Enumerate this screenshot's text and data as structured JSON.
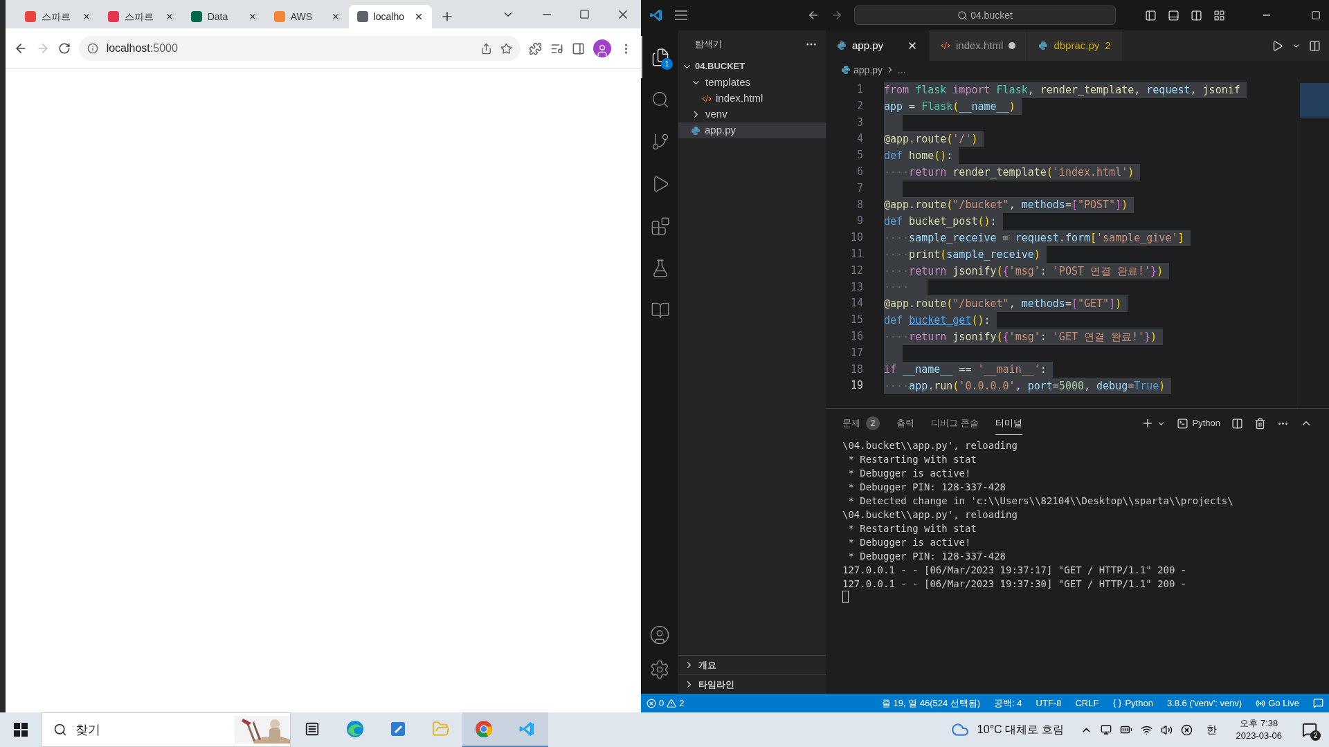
{
  "browser": {
    "tabs": [
      {
        "title": "스파르",
        "selected": false,
        "color": "#e8453c"
      },
      {
        "title": "스파르",
        "selected": false,
        "color": "#e8344e"
      },
      {
        "title": "Data",
        "selected": false,
        "color": "#00684a"
      },
      {
        "title": "AWS",
        "selected": false,
        "color": "#f58536"
      },
      {
        "title": "localho",
        "selected": true,
        "color": "#5f6368"
      }
    ],
    "address": {
      "host": "localhost",
      "port": ":5000"
    }
  },
  "vscode": {
    "title_search": "04.bucket",
    "activity": [
      {
        "kind": "files",
        "selected": true,
        "badge": "1"
      },
      {
        "kind": "search",
        "selected": false
      },
      {
        "kind": "git",
        "selected": false
      },
      {
        "kind": "debug",
        "selected": false
      },
      {
        "kind": "extensions",
        "selected": false
      },
      {
        "kind": "testing",
        "selected": false
      },
      {
        "kind": "notebook",
        "selected": false
      }
    ],
    "sidebar": {
      "title": "탐색기",
      "root": "04.BUCKET",
      "items": [
        {
          "name": "templates",
          "kind": "folder",
          "expanded": true,
          "selected": false,
          "children": [
            {
              "name": "index.html",
              "kind": "html",
              "selected": false
            }
          ]
        },
        {
          "name": "venv",
          "kind": "folder",
          "expanded": false,
          "selected": false
        },
        {
          "name": "app.py",
          "kind": "python",
          "selected": true
        }
      ],
      "sections": [
        {
          "title": "개요",
          "expanded": false
        },
        {
          "title": "타임라인",
          "expanded": false
        }
      ]
    },
    "editor_tabs": [
      {
        "name": "app.py",
        "kind": "python",
        "selected": true,
        "modified": false
      },
      {
        "name": "index.html",
        "kind": "html",
        "selected": false,
        "modified": true
      },
      {
        "name": "dbprac.py",
        "kind": "python",
        "selected": false,
        "modified": false,
        "problems": "2"
      }
    ],
    "breadcrumb": [
      "app.py",
      "..."
    ],
    "code": {
      "selected": true,
      "lines": [
        {
          "n": "1",
          "current": false,
          "indent": false,
          "tokens": [
            {
              "text": "from",
              "kind": "kw"
            },
            {
              "text": " flask",
              "kind": "cls"
            },
            {
              "text": " import",
              "kind": "kw"
            },
            {
              "text": " Flask",
              "kind": "cls"
            },
            {
              "text": ", ",
              "kind": "p"
            },
            {
              "text": "render_template",
              "kind": "fn"
            },
            {
              "text": ", ",
              "kind": "p"
            },
            {
              "text": "request",
              "kind": "var"
            },
            {
              "text": ", ",
              "kind": "p"
            },
            {
              "text": "jsonif",
              "kind": "fn"
            }
          ]
        },
        {
          "n": "2",
          "current": false,
          "indent": false,
          "tokens": [
            {
              "text": "app",
              "kind": "var"
            },
            {
              "text": " = ",
              "kind": "p"
            },
            {
              "text": "Flask",
              "kind": "cls"
            },
            {
              "text": "(",
              "kind": "b1"
            },
            {
              "text": "__name__",
              "kind": "var"
            },
            {
              "text": ")",
              "kind": "b1"
            }
          ]
        },
        {
          "n": "3",
          "current": false,
          "indent": false
        },
        {
          "n": "4",
          "current": false,
          "indent": false,
          "tokens": [
            {
              "text": "@app.route",
              "kind": "fn"
            },
            {
              "text": "(",
              "kind": "b1"
            },
            {
              "text": "'/'",
              "kind": "str"
            },
            {
              "text": ")",
              "kind": "b1"
            }
          ]
        },
        {
          "n": "5",
          "current": false,
          "indent": false,
          "tokens": [
            {
              "text": "def",
              "kind": "st"
            },
            {
              "text": " home",
              "kind": "fn"
            },
            {
              "text": "()",
              "kind": "b1"
            },
            {
              "text": ":",
              "kind": "p"
            }
          ]
        },
        {
          "n": "6",
          "current": false,
          "indent": true,
          "tokens": [
            {
              "text": "return",
              "kind": "kw"
            },
            {
              "text": " render_template",
              "kind": "fn"
            },
            {
              "text": "(",
              "kind": "b1"
            },
            {
              "text": "'index.html'",
              "kind": "str"
            },
            {
              "text": ")",
              "kind": "b1"
            }
          ]
        },
        {
          "n": "7",
          "current": false,
          "indent": false
        },
        {
          "n": "8",
          "current": false,
          "indent": false,
          "tokens": [
            {
              "text": "@app.route",
              "kind": "fn"
            },
            {
              "text": "(",
              "kind": "b1"
            },
            {
              "text": "\"/bucket\"",
              "kind": "str"
            },
            {
              "text": ", ",
              "kind": "p"
            },
            {
              "text": "methods",
              "kind": "var"
            },
            {
              "text": "=",
              "kind": "p"
            },
            {
              "text": "[",
              "kind": "b2"
            },
            {
              "text": "\"POST\"",
              "kind": "str"
            },
            {
              "text": "]",
              "kind": "b2"
            },
            {
              "text": ")",
              "kind": "b1"
            }
          ]
        },
        {
          "n": "9",
          "current": false,
          "indent": false,
          "tokens": [
            {
              "text": "def",
              "kind": "st"
            },
            {
              "text": " bucket_post",
              "kind": "fn"
            },
            {
              "text": "()",
              "kind": "b1"
            },
            {
              "text": ":",
              "kind": "p"
            }
          ]
        },
        {
          "n": "10",
          "current": false,
          "indent": true,
          "tokens": [
            {
              "text": "sample_receive",
              "kind": "var"
            },
            {
              "text": " = ",
              "kind": "p"
            },
            {
              "text": "request",
              "kind": "var"
            },
            {
              "text": ".",
              "kind": "p"
            },
            {
              "text": "form",
              "kind": "var"
            },
            {
              "text": "[",
              "kind": "b1"
            },
            {
              "text": "'sample_give'",
              "kind": "str"
            },
            {
              "text": "]",
              "kind": "b1"
            }
          ]
        },
        {
          "n": "11",
          "current": false,
          "indent": true,
          "tokens": [
            {
              "text": "print",
              "kind": "fn"
            },
            {
              "text": "(",
              "kind": "b1"
            },
            {
              "text": "sample_receive",
              "kind": "var"
            },
            {
              "text": ")",
              "kind": "b1"
            }
          ]
        },
        {
          "n": "12",
          "current": false,
          "indent": true,
          "tokens": [
            {
              "text": "return",
              "kind": "kw"
            },
            {
              "text": " jsonify",
              "kind": "fn"
            },
            {
              "text": "(",
              "kind": "b1"
            },
            {
              "text": "{",
              "kind": "b2"
            },
            {
              "text": "'msg'",
              "kind": "str"
            },
            {
              "text": ": ",
              "kind": "p"
            },
            {
              "text": "'POST 연결 완료!'",
              "kind": "str"
            },
            {
              "text": "}",
              "kind": "b2"
            },
            {
              "text": ")",
              "kind": "b1"
            }
          ]
        },
        {
          "n": "13",
          "current": false,
          "indent": true
        },
        {
          "n": "14",
          "current": false,
          "indent": false,
          "tokens": [
            {
              "text": "@app.route",
              "kind": "fn"
            },
            {
              "text": "(",
              "kind": "b1"
            },
            {
              "text": "\"/bucket\"",
              "kind": "str"
            },
            {
              "text": ", ",
              "kind": "p"
            },
            {
              "text": "methods",
              "kind": "var"
            },
            {
              "text": "=",
              "kind": "p"
            },
            {
              "text": "[",
              "kind": "b2"
            },
            {
              "text": "\"GET\"",
              "kind": "str"
            },
            {
              "text": "]",
              "kind": "b2"
            },
            {
              "text": ")",
              "kind": "b1"
            }
          ]
        },
        {
          "n": "15",
          "current": false,
          "indent": false,
          "tokens": [
            {
              "text": "def ",
              "kind": "st"
            },
            {
              "text": "bucket_get",
              "kind": "link"
            },
            {
              "text": "()",
              "kind": "b1"
            },
            {
              "text": ":",
              "kind": "p"
            }
          ]
        },
        {
          "n": "16",
          "current": false,
          "indent": true,
          "tokens": [
            {
              "text": "return",
              "kind": "kw"
            },
            {
              "text": " jsonify",
              "kind": "fn"
            },
            {
              "text": "(",
              "kind": "b1"
            },
            {
              "text": "{",
              "kind": "b2"
            },
            {
              "text": "'msg'",
              "kind": "str"
            },
            {
              "text": ": ",
              "kind": "p"
            },
            {
              "text": "'GET 연결 완료!'",
              "kind": "str"
            },
            {
              "text": "}",
              "kind": "b2"
            },
            {
              "text": ")",
              "kind": "b1"
            }
          ]
        },
        {
          "n": "17",
          "current": false,
          "indent": false
        },
        {
          "n": "18",
          "current": false,
          "indent": false,
          "tokens": [
            {
              "text": "if",
              "kind": "kw"
            },
            {
              "text": " __name__",
              "kind": "var"
            },
            {
              "text": " == ",
              "kind": "p"
            },
            {
              "text": "'__main__'",
              "kind": "str"
            },
            {
              "text": ":",
              "kind": "p"
            }
          ]
        },
        {
          "n": "19",
          "current": true,
          "indent": true,
          "tokens": [
            {
              "text": "app",
              "kind": "var"
            },
            {
              "text": ".",
              "kind": "p"
            },
            {
              "text": "run",
              "kind": "fn"
            },
            {
              "text": "(",
              "kind": "b1"
            },
            {
              "text": "'0.0.0.0'",
              "kind": "str"
            },
            {
              "text": ", ",
              "kind": "p"
            },
            {
              "text": "port",
              "kind": "var"
            },
            {
              "text": "=",
              "kind": "p"
            },
            {
              "text": "5000",
              "kind": "num"
            },
            {
              "text": ", ",
              "kind": "p"
            },
            {
              "text": "debug",
              "kind": "var"
            },
            {
              "text": "=",
              "kind": "p"
            },
            {
              "text": "True",
              "kind": "st"
            },
            {
              "text": ")",
              "kind": "b1"
            }
          ]
        }
      ]
    },
    "panel": {
      "tabs": [
        {
          "label": "문제",
          "selected": false,
          "badge": "2"
        },
        {
          "label": "출력",
          "selected": false
        },
        {
          "label": "디버그 콘솔",
          "selected": false
        },
        {
          "label": "터미널",
          "selected": true
        }
      ],
      "terminal_name": "Python",
      "lines": [
        "\\04.bucket\\\\app.py', reloading",
        " * Restarting with stat",
        " * Debugger is active!",
        " * Debugger PIN: 128-337-428",
        " * Detected change in 'c:\\\\Users\\\\82104\\\\Desktop\\\\sparta\\\\projects\\",
        "\\04.bucket\\\\app.py', reloading",
        " * Restarting with stat",
        " * Debugger is active!",
        " * Debugger PIN: 128-337-428",
        "127.0.0.1 - - [06/Mar/2023 19:37:17] \"GET / HTTP/1.1\" 200 -",
        "127.0.0.1 - - [06/Mar/2023 19:37:30] \"GET / HTTP/1.1\" 200 -"
      ]
    },
    "status": {
      "errors": "0",
      "warnings": "2",
      "position": "줄 19, 열 46(524 선택됨)",
      "spaces": "공백: 4",
      "encoding": "UTF-8",
      "eol": "CRLF",
      "language": "Python",
      "interpreter": "3.8.6 ('venv': venv)",
      "live": "Go Live"
    }
  },
  "taskbar": {
    "search": "찾기",
    "apps": [
      {
        "kind": "taskview",
        "active": false
      },
      {
        "kind": "edge",
        "active": false
      },
      {
        "kind": "hancom",
        "active": false
      },
      {
        "kind": "explorer",
        "active": false
      },
      {
        "kind": "chrome",
        "active": true
      },
      {
        "kind": "vscode",
        "active": true
      }
    ],
    "weather": "10°C 대체로 흐림",
    "ime": "한",
    "time": "오후 7:38",
    "date": "2023-03-06",
    "notifications": "2"
  }
}
